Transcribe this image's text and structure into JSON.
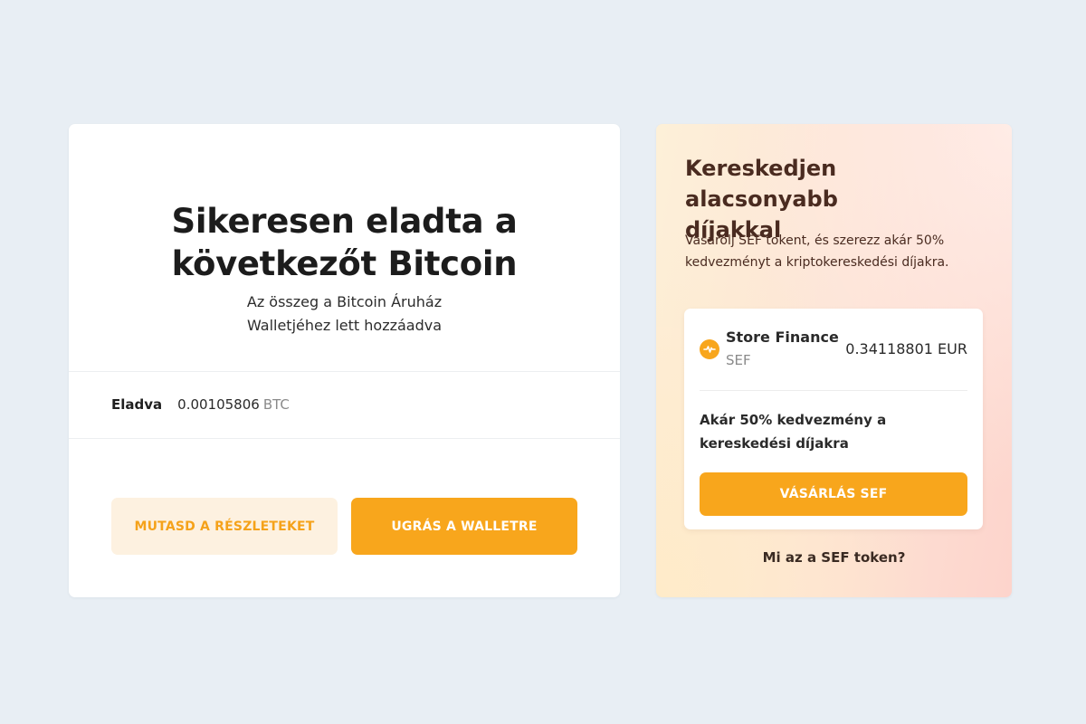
{
  "success_card": {
    "title_lines": [
      "Sikeresen eladta a",
      "következőt Bitcoin"
    ],
    "subtitle_lines": [
      "Az összeg a Bitcoin Áruház",
      "Walletjéhez lett hozzáadva"
    ],
    "sold": {
      "label": "Eladva",
      "amount": "0.00105806",
      "unit": "BTC"
    },
    "buttons": {
      "details_label": "MUTASD A RÉSZLETEKET",
      "wallet_label": "UGRÁS A WALLETRE"
    }
  },
  "promo_card": {
    "title_lines": [
      "Kereskedjen alacsonyabb",
      "díjakkal"
    ],
    "description_lines": [
      "Vásárolj SEF tokent, és szerezz akár 50%",
      "kedvezményt a kriptokereskedési díjakra."
    ],
    "token": {
      "icon": "store-finance-logo-icon",
      "name": "Store Finance",
      "symbol": "SEF",
      "price": "0.34118801 EUR",
      "benefit_lines": [
        "Akár 50% kedvezmény a",
        "kereskedési díjakra"
      ],
      "buy_label": "VÁSÁRLÁS SEF"
    },
    "info_link": "Mi az a SEF token?"
  },
  "colors": {
    "accent": "#f8a61c",
    "accent_light": "#fdf1e0",
    "page_background": "#e8eef4",
    "promo_text": "#4a2b20"
  }
}
